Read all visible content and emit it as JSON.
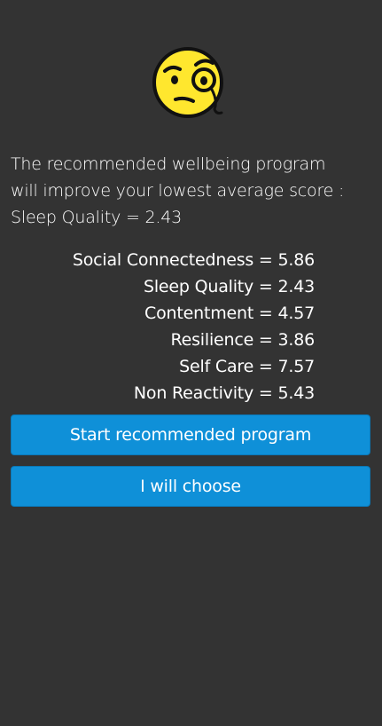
{
  "header": {
    "icon": "face-with-monocle-icon"
  },
  "message": {
    "line1": "The recommended wellbeing program",
    "line2": "will improve your lowest average score :",
    "line3": "Sleep Quality = 2.43"
  },
  "scores": [
    {
      "label": "Social Connectedness = 5.86"
    },
    {
      "label": "Sleep Quality = 2.43"
    },
    {
      "label": "Contentment = 4.57"
    },
    {
      "label": "Resilience = 3.86"
    },
    {
      "label": "Self Care = 7.57"
    },
    {
      "label": "Non Reactivity = 5.43"
    }
  ],
  "actions": {
    "start_label": "Start recommended program",
    "choose_label": "I will choose"
  },
  "colors": {
    "background": "#333333",
    "button": "#0f90d8",
    "emoji": "#ffe033"
  }
}
